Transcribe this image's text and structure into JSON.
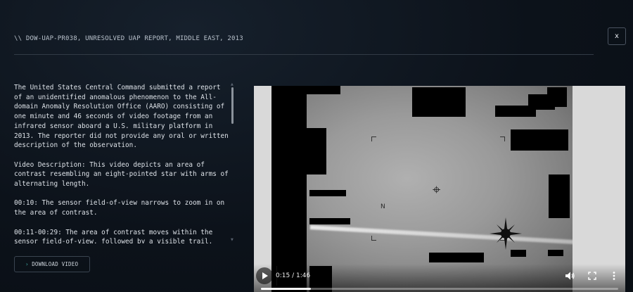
{
  "header": {
    "title": "\\\\  DOW-UAP-PR038, UNRESOLVED UAP REPORT, MIDDLE EAST, 2013"
  },
  "close_label": "x",
  "description": {
    "paragraphs": [
      "The United States Central Command submitted a report of an unidentified anomalous phenomenon to the All-domain Anomaly Resolution Office (AARO) consisting of one minute and 46 seconds of video footage from an infrared sensor aboard a U.S. military platform in 2013. The reporter did not provide any oral or written description of the observation.",
      "Video Description: This video depicts an area of contrast resembling an eight-pointed star with arms of alternating length.",
      "00:10: The sensor field-of-view narrows to zoom in on the area of contrast.",
      "00:11-00:29: The area of contrast moves within the sensor field-of-view, followed by a visible trail."
    ]
  },
  "download": {
    "icon": "chevron-right-icon",
    "label": "DOWNLOAD VIDEO"
  },
  "video": {
    "time_display": "0:15 / 1:46",
    "progress": 0.14,
    "frame_marker": "N",
    "icons": {
      "play": "play-icon",
      "volume": "volume-icon",
      "fullscreen": "fullscreen-icon",
      "more": "more-vertical-icon"
    }
  },
  "colors": {
    "accent": "#3fa6a0",
    "background": "#0c121a",
    "divider": "#323b46"
  }
}
